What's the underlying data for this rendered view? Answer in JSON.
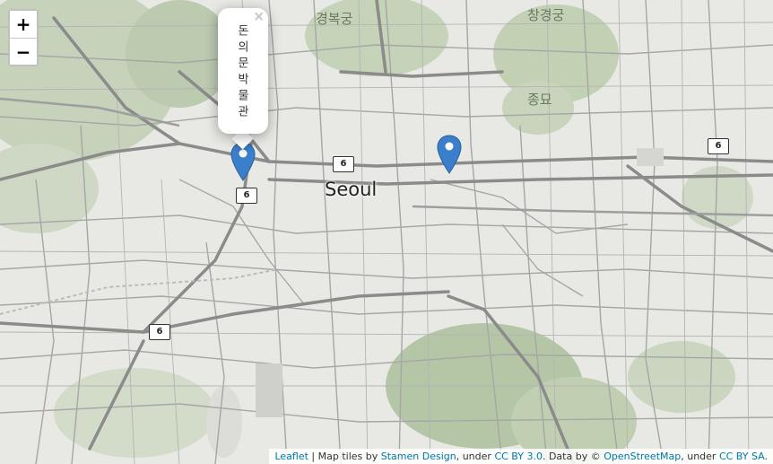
{
  "zoom": {
    "in_label": "+",
    "out_label": "−"
  },
  "popup": {
    "text": "돈의문박물관",
    "close_label": "×"
  },
  "map_labels": {
    "city": "Seoul",
    "palace_north": "경복궁",
    "palace_east": "창경궁",
    "shrine": "종묘"
  },
  "route_shields": [
    "6",
    "6",
    "6",
    "6"
  ],
  "attribution": {
    "leaflet": "Leaflet",
    "sep": " | Map tiles by ",
    "stamen": "Stamen Design",
    "under1": ", under ",
    "cc_by": "CC BY 3.0",
    "data_by": ". Data by © ",
    "osm": "OpenStreetMap",
    "under2": ", under ",
    "cc_by_sa": "CC BY SA",
    "end": "."
  },
  "colors": {
    "marker": "#3a7fcc",
    "park": "#b9c9a9",
    "road": "#9a9a9a",
    "major_road": "#7d7d7d"
  }
}
